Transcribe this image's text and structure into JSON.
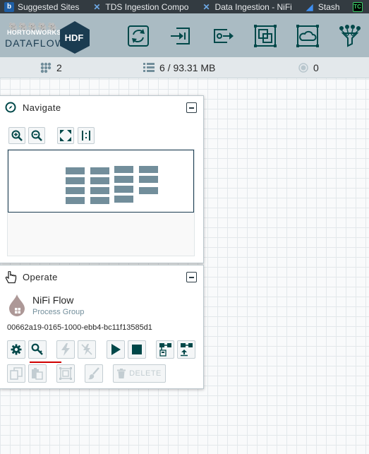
{
  "bookmarks": [
    {
      "label": "Suggested Sites",
      "icon": "bing-icon"
    },
    {
      "label": "TDS Ingestion Compo",
      "icon": "nifi-x-icon"
    },
    {
      "label": "Data Ingestion - NiFi",
      "icon": "nifi-x-icon"
    },
    {
      "label": "Stash",
      "icon": "stash-icon"
    },
    {
      "label": "",
      "icon": "teamcity-icon"
    }
  ],
  "header": {
    "logo_brand": "HORTONWORKS",
    "logo_product": "DATAFLOW",
    "logo_badge": "HDF",
    "toolbar_icons": [
      "process-group-icon",
      "input-port-icon",
      "output-port-icon",
      "template-icon",
      "remote-process-group-icon",
      "funnel-icon"
    ]
  },
  "status": {
    "threads": "2",
    "queued": "6 / 93.31 MB",
    "transmitting": "0"
  },
  "navigate": {
    "title": "Navigate"
  },
  "operate": {
    "title": "Operate",
    "name": "NiFi Flow",
    "type": "Process Group",
    "id": "00662a19-0165-1000-ebb4-bc11f13585d1",
    "delete_label": "DELETE"
  },
  "colors": {
    "header": "#aabbc3",
    "dark": "#004849",
    "bookmarks_bar": "#333b41",
    "highlight_underline": "#d00000"
  }
}
